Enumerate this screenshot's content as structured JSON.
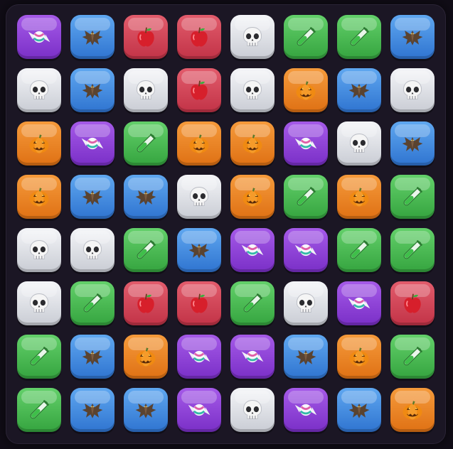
{
  "board": {
    "rows": [
      [
        "candy",
        "bat",
        "apple",
        "apple",
        "skull",
        "potion",
        "potion",
        "bat"
      ],
      [
        "skull",
        "bat",
        "skull",
        "apple",
        "skull",
        "pumpkin",
        "bat",
        "skull"
      ],
      [
        "pumpkin",
        "candy",
        "potion",
        "pumpkin",
        "pumpkin",
        "candy",
        "skull",
        "bat"
      ],
      [
        "pumpkin",
        "bat",
        "bat",
        "skull",
        "pumpkin",
        "potion",
        "pumpkin",
        "potion"
      ],
      [
        "skull",
        "skull",
        "potion",
        "bat",
        "candy",
        "candy",
        "potion",
        "potion"
      ],
      [
        "skull",
        "potion",
        "apple",
        "apple",
        "potion",
        "skull",
        "candy",
        "apple"
      ],
      [
        "potion",
        "bat",
        "pumpkin",
        "candy",
        "candy",
        "bat",
        "pumpkin",
        "potion"
      ],
      [
        "potion",
        "bat",
        "bat",
        "candy",
        "skull",
        "candy",
        "bat",
        "pumpkin"
      ]
    ]
  },
  "pieces": {
    "candy": {
      "icon": "candy-icon",
      "color": "#8b3fd9"
    },
    "bat": {
      "icon": "bat-icon",
      "color": "#3b85e0"
    },
    "apple": {
      "icon": "apple-icon",
      "color": "#d4434f"
    },
    "skull": {
      "icon": "skull-icon",
      "color": "#dcdfe5"
    },
    "potion": {
      "icon": "test-tube-icon",
      "color": "#4bbb54"
    },
    "pumpkin": {
      "icon": "jack-o-lantern-icon",
      "color": "#ec8424"
    }
  }
}
